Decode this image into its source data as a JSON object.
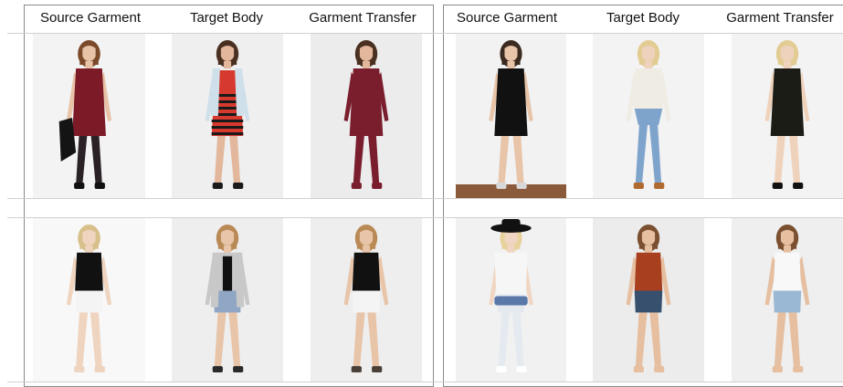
{
  "panels": [
    {
      "headers": [
        "Source Garment",
        "Target Body",
        "Garment Transfer"
      ],
      "rows": [
        [
          {
            "pose": "front",
            "hair": "#7a4a2a",
            "skin": "#e8c3a8",
            "top": "#7c1a28",
            "bottom": "#7c1a28",
            "style": "dress",
            "legs": "#2a2226",
            "shoes": "#111111",
            "bg": "#f3f3f3",
            "prop": "jacket"
          },
          {
            "pose": "front",
            "hair": "#4a3020",
            "skin": "#e3b79b",
            "top": "#cfe0ea",
            "bottom": "#d63a2e",
            "style": "stripe-dress",
            "legs": "#e3b79b",
            "shoes": "#1a1a1a",
            "bg": "#efefef",
            "prop": "none"
          },
          {
            "pose": "front",
            "hair": "#4a3020",
            "skin": "#e3b79b",
            "top": "#7a1e2e",
            "bottom": "#7a1e2e",
            "style": "tunic",
            "legs": "#7a1e2e",
            "shoes": "#7a1e2e",
            "bg": "#ececec",
            "prop": "none"
          }
        ],
        [
          {
            "pose": "front",
            "hair": "#d7c08a",
            "skin": "#efd4bf",
            "top": "#111111",
            "bottom": "#f4f4f4",
            "style": "top-shorts",
            "legs": "#efd4bf",
            "shoes": "#efd4bf",
            "bg": "#f8f8f8",
            "prop": "none"
          },
          {
            "pose": "front",
            "hair": "#b98a55",
            "skin": "#e8c4a8",
            "top": "#c8c8c8",
            "bottom": "#8fa6c4",
            "style": "cardigan-shorts",
            "legs": "#e8c4a8",
            "shoes": "#2a2a2a",
            "bg": "#eeeeee",
            "prop": "none"
          },
          {
            "pose": "front",
            "hair": "#b98a55",
            "skin": "#e8c4a8",
            "top": "#111111",
            "bottom": "#f4f4f4",
            "style": "top-shorts",
            "legs": "#e8c4a8",
            "shoes": "#4a4038",
            "bg": "#eeeeee",
            "prop": "none"
          }
        ]
      ]
    },
    {
      "headers": [
        "Source Garment",
        "Target Body",
        "Garment Transfer"
      ],
      "rows": [
        [
          {
            "pose": "back",
            "hair": "#3a2a20",
            "skin": "#e8c4a8",
            "top": "#111111",
            "bottom": "#111111",
            "style": "dress",
            "legs": "#e8c4a8",
            "shoes": "#d8d8d8",
            "bg": "#f2f2f2",
            "prop": "floor"
          },
          {
            "pose": "front",
            "hair": "#e2cc93",
            "skin": "#efd2bc",
            "top": "#efece4",
            "bottom": "#7fa4cc",
            "style": "jeans",
            "legs": "#7fa4cc",
            "shoes": "#b06a30",
            "bg": "#f3f3f3",
            "prop": "none"
          },
          {
            "pose": "front",
            "hair": "#e2cc93",
            "skin": "#efd2bc",
            "top": "#1c1c16",
            "bottom": "#1c1c16",
            "style": "dress",
            "legs": "#efd2bc",
            "shoes": "#111111",
            "bg": "#f3f3f3",
            "prop": "none"
          }
        ],
        [
          {
            "pose": "front",
            "hair": "#e8d29c",
            "skin": "#f0d6c2",
            "top": "#f6f6f6",
            "bottom": "#e4eaf0",
            "style": "tee-jeans",
            "legs": "#e4eaf0",
            "shoes": "#ffffff",
            "bg": "#f1f1f1",
            "prop": "hat"
          },
          {
            "pose": "front",
            "hair": "#7a5030",
            "skin": "#e6bfa0",
            "top": "#a84020",
            "bottom": "#36506e",
            "style": "top-shorts",
            "legs": "#e6bfa0",
            "shoes": "#e6bfa0",
            "bg": "#ececec",
            "prop": "none"
          },
          {
            "pose": "front",
            "hair": "#7a5030",
            "skin": "#e6bfa0",
            "top": "#f8f8f8",
            "bottom": "#9ab8d4",
            "style": "top-shorts",
            "legs": "#e6bfa0",
            "shoes": "#e6bfa0",
            "bg": "#efefef",
            "prop": "none"
          }
        ]
      ]
    }
  ]
}
